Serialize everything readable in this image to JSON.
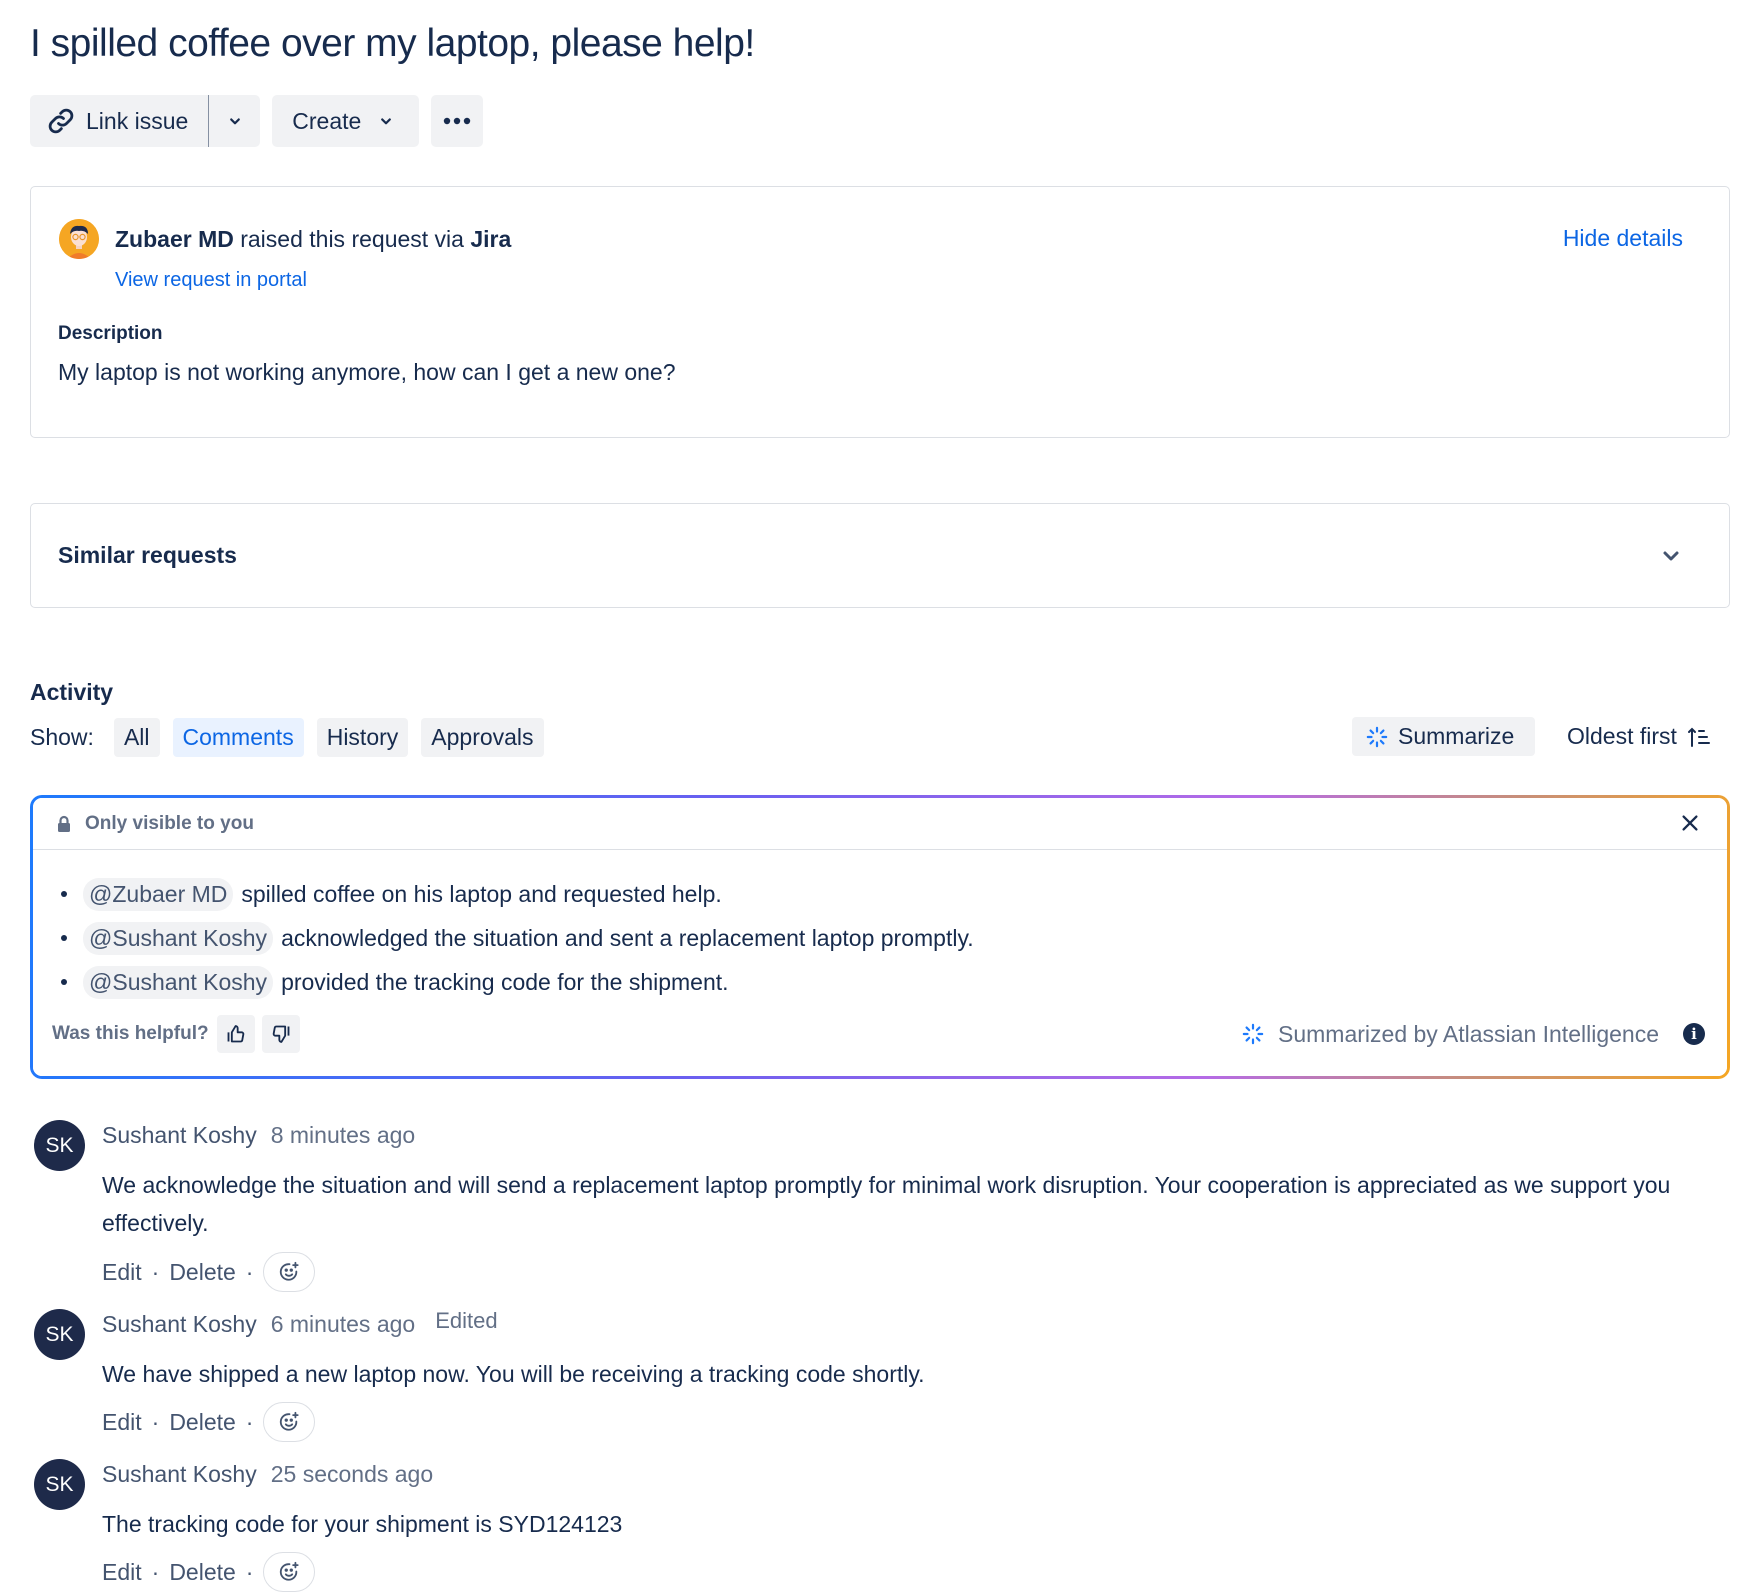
{
  "issue": {
    "title": "I spilled coffee over my laptop, please help!"
  },
  "toolbar": {
    "link_issue_label": "Link issue",
    "link_icon": "link-icon",
    "link_dropdown_icon": "chevron-down-icon",
    "create_label": "Create",
    "create_icon": "chevron-down-icon",
    "more_icon": "more-icon"
  },
  "details": {
    "reporter_name": "Zubaer MD",
    "raised_text": "raised this request via",
    "channel": "Jira",
    "portal_link": "View request in portal",
    "hide_details": "Hide details",
    "description_label": "Description",
    "description": "My laptop is not working anymore, how can I get a new one?"
  },
  "similar": {
    "label": "Similar requests",
    "icon": "chevron-down-icon"
  },
  "activity": {
    "label": "Activity",
    "show_label": "Show:",
    "filters": [
      {
        "label": "All",
        "active": false
      },
      {
        "label": "Comments",
        "active": true
      },
      {
        "label": "History",
        "active": false
      },
      {
        "label": "Approvals",
        "active": false
      }
    ],
    "summarize_label": "Summarize",
    "sort_label": "Oldest first"
  },
  "ai_summary": {
    "visibility": "Only visible to you",
    "items": [
      {
        "mention": "@Zubaer MD",
        "text": "spilled coffee on his laptop and requested help."
      },
      {
        "mention": "@Sushant Koshy",
        "text": "acknowledged the situation and sent a replacement laptop promptly."
      },
      {
        "mention": "@Sushant Koshy",
        "text": "provided the tracking code for the shipment."
      }
    ],
    "helpful_label": "Was this helpful?",
    "credit": "Summarized by Atlassian Intelligence",
    "colors": {
      "gradient_start": "#1d7afc",
      "gradient_mid": "#b56be6",
      "gradient_end": "#f5a623"
    }
  },
  "comments": [
    {
      "initials": "SK",
      "author": "Sushant Koshy",
      "time": "8 minutes ago",
      "edited": "",
      "body": "We acknowledge the situation and will send a replacement laptop promptly for minimal work disruption. Your cooperation is appreciated as we support you effectively.",
      "edit_label": "Edit",
      "delete_label": "Delete"
    },
    {
      "initials": "SK",
      "author": "Sushant Koshy",
      "time": "6 minutes ago",
      "edited": "Edited",
      "body": "We have shipped a new laptop now. You will be receiving a tracking code shortly.",
      "edit_label": "Edit",
      "delete_label": "Delete"
    },
    {
      "initials": "SK",
      "author": "Sushant Koshy",
      "time": "25 seconds ago",
      "edited": "",
      "body": "The tracking code for your shipment is SYD124123",
      "edit_label": "Edit",
      "delete_label": "Delete"
    }
  ],
  "colors": {
    "text_primary": "#172b4d",
    "link": "#0c66e4",
    "subtle": "#626f86",
    "button_bg": "#f1f2f4",
    "chip_active_bg": "#e9f2ff",
    "avatar_bg": "#1e2a4a"
  }
}
